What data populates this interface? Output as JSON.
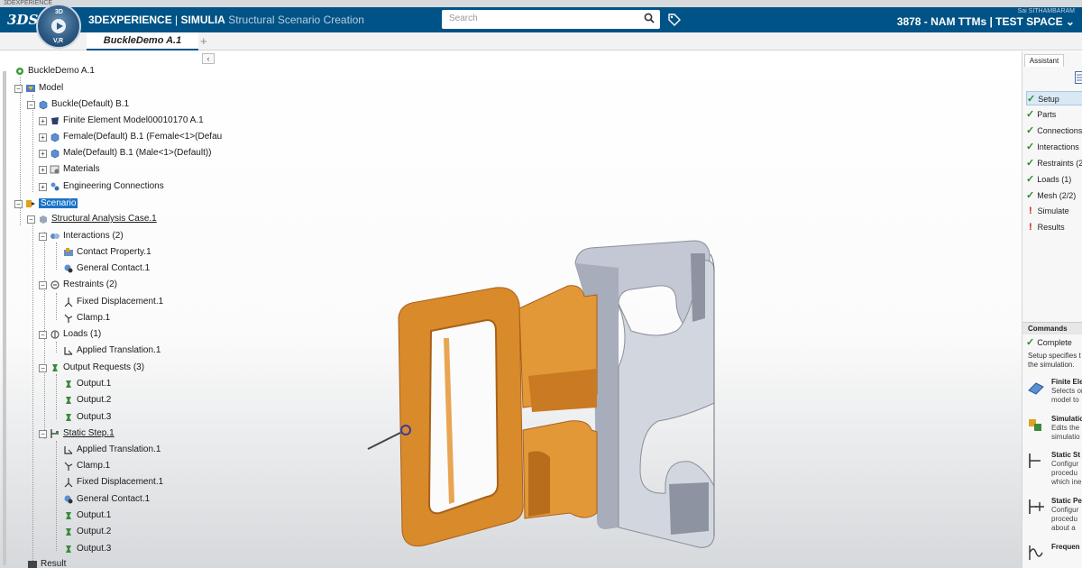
{
  "window": {
    "strip_title": "3DEXPERIENCE"
  },
  "header": {
    "logo": "3DS",
    "compass_top": "3D",
    "compass_left": "V,R",
    "brand": "3DEXPERIENCE",
    "separator": " | ",
    "brand_module": "SIMULIA",
    "app_name": "Structural Scenario Creation",
    "search_placeholder": "Search",
    "user_name": "Sai SITHAMBARAM",
    "space": "3878 - NAM TTMs | TEST SPACE ⌄"
  },
  "tabs": {
    "active": "BuckleDemo A.1",
    "add": "+"
  },
  "tree": {
    "collapse": "‹",
    "nodes": [
      {
        "label": "BuckleDemo A.1",
        "icon": "product-root-icon"
      },
      {
        "label": "Model",
        "icon": "model-icon"
      },
      {
        "label": "Buckle(Default) B.1",
        "icon": "part-icon"
      },
      {
        "label": "Finite Element Model00010170 A.1",
        "icon": "fem-icon"
      },
      {
        "label": "Female(Default) B.1 (Female<1>(Defau",
        "icon": "part-icon"
      },
      {
        "label": "Male(Default) B.1 (Male<1>(Default))",
        "icon": "part-icon"
      },
      {
        "label": "Materials",
        "icon": "materials-icon"
      },
      {
        "label": "Engineering Connections",
        "icon": "connections-icon"
      },
      {
        "label": "Scenario",
        "icon": "scenario-icon"
      },
      {
        "label": "Structural Analysis Case.1",
        "icon": "analysis-case-icon"
      },
      {
        "label": "Interactions (2)",
        "icon": "interactions-icon"
      },
      {
        "label": "Contact Property.1",
        "icon": "contact-property-icon"
      },
      {
        "label": "General Contact.1",
        "icon": "general-contact-icon"
      },
      {
        "label": "Restraints (2)",
        "icon": "restraints-icon"
      },
      {
        "label": "Fixed Displacement.1",
        "icon": "fixed-displacement-icon"
      },
      {
        "label": "Clamp.1",
        "icon": "clamp-icon"
      },
      {
        "label": "Loads (1)",
        "icon": "loads-icon"
      },
      {
        "label": "Applied Translation.1",
        "icon": "applied-translation-icon"
      },
      {
        "label": "Output Requests (3)",
        "icon": "output-requests-icon"
      },
      {
        "label": "Output.1",
        "icon": "output-icon"
      },
      {
        "label": "Output.2",
        "icon": "output-icon"
      },
      {
        "label": "Output.3",
        "icon": "output-icon"
      },
      {
        "label": "Static Step.1",
        "icon": "static-step-icon"
      },
      {
        "label": "Applied Translation.1",
        "icon": "applied-translation-icon"
      },
      {
        "label": "Clamp.1",
        "icon": "clamp-icon"
      },
      {
        "label": "Fixed Displacement.1",
        "icon": "fixed-displacement-icon"
      },
      {
        "label": "General Contact.1",
        "icon": "general-contact-icon"
      },
      {
        "label": "Output.1",
        "icon": "output-icon"
      },
      {
        "label": "Output.2",
        "icon": "output-icon"
      },
      {
        "label": "Output.3",
        "icon": "output-icon"
      },
      {
        "label": "Result",
        "icon": "result-icon"
      }
    ]
  },
  "assistant": {
    "tab": "Assistant",
    "steps": [
      {
        "label": "Setup",
        "status": "done"
      },
      {
        "label": "Parts",
        "status": "done"
      },
      {
        "label": "Connections",
        "status": "done"
      },
      {
        "label": "Interactions",
        "status": "done"
      },
      {
        "label": "Restraints (2",
        "status": "done"
      },
      {
        "label": "Loads (1)",
        "status": "done"
      },
      {
        "label": "Mesh (2/2)",
        "status": "done"
      },
      {
        "label": "Simulate",
        "status": "todo"
      },
      {
        "label": "Results",
        "status": "todo"
      }
    ],
    "commands_header": "Commands",
    "complete": "Complete",
    "desc_line1": "Setup specifies t",
    "desc_line2": "the simulation.",
    "commands": [
      {
        "title": "Finite Ele",
        "line1": "Selects or",
        "line2": "model to",
        "icon": "finite-element-icon"
      },
      {
        "title": "Simulatio",
        "line1": "Edits the",
        "line2": "simulatio",
        "icon": "simulation-icon"
      },
      {
        "title": "Static St",
        "line1": "Configur",
        "line2": "procedu",
        "line3": "which ine",
        "icon": "static-step-icon"
      },
      {
        "title": "Static Pe",
        "line1": "Configur",
        "line2": "procedu",
        "line3": "about a",
        "icon": "static-perturbation-icon"
      },
      {
        "title": "Frequen",
        "line1": "",
        "line2": "",
        "icon": "frequency-icon"
      }
    ]
  },
  "colors": {
    "topbar": "#005386",
    "buckle_female": "#d98a2b",
    "buckle_male": "#b7bcc9",
    "selection": "#1a73c8",
    "check": "#2a8a2a",
    "warning": "#d01f1f"
  }
}
